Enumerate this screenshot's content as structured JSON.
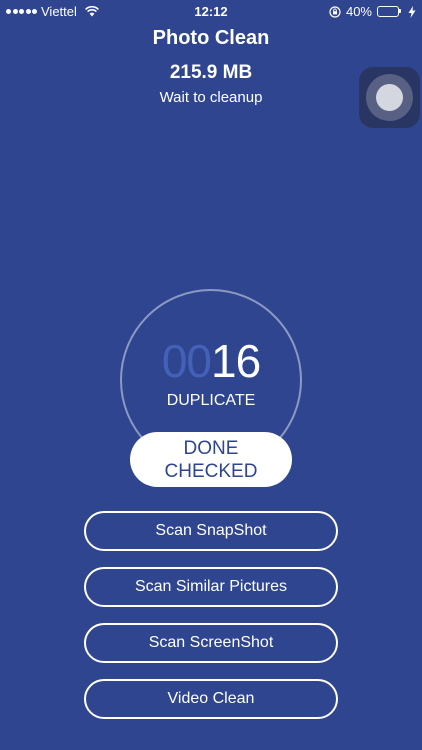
{
  "status_bar": {
    "carrier": "Viettel",
    "time": "12:12",
    "battery_percent": "40%",
    "battery_level": 0.4,
    "battery_color": "#4cd964",
    "icons": [
      "signal-dots-icon",
      "wifi-icon",
      "orientation-lock-icon",
      "battery-icon",
      "charging-bolt-icon"
    ]
  },
  "header": {
    "title": "Photo Clean",
    "size": "215.9 MB",
    "subtitle": "Wait to cleanup"
  },
  "counter": {
    "leading_zeros": "00",
    "value": "16",
    "label": "DUPLICATE"
  },
  "done_button": {
    "line1": "DONE",
    "line2": "CHECKED"
  },
  "actions": [
    {
      "label": "Scan SnapShot"
    },
    {
      "label": "Scan Similar Pictures"
    },
    {
      "label": "Scan ScreenShot"
    },
    {
      "label": "Video Clean"
    }
  ],
  "colors": {
    "background": "#2f4590",
    "accent_dim": "#4461b8",
    "text": "#ffffff"
  }
}
